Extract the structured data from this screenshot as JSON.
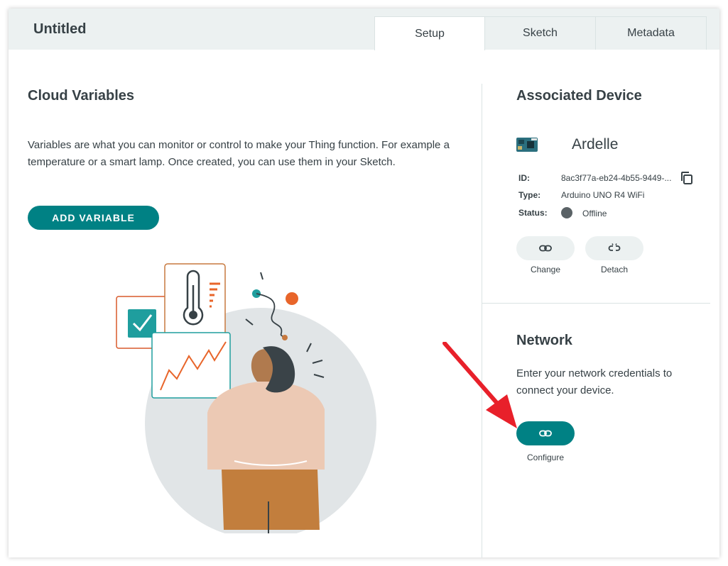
{
  "header": {
    "title": "Untitled",
    "tabs": [
      {
        "label": "Setup",
        "active": true
      },
      {
        "label": "Sketch",
        "active": false
      },
      {
        "label": "Metadata",
        "active": false
      }
    ]
  },
  "variables": {
    "title": "Cloud Variables",
    "description": "Variables are what you can monitor or control to make your Thing function. For example a temperature or a smart lamp. Once created, you can use them in your Sketch.",
    "add_button": "ADD VARIABLE"
  },
  "device": {
    "section_title": "Associated Device",
    "name": "Ardelle",
    "id_label": "ID:",
    "id_value": "8ac3f77a-eb24-4b55-9449-...",
    "type_label": "Type:",
    "type_value": "Arduino UNO R4 WiFi",
    "status_label": "Status:",
    "status_value": "Offline",
    "change_label": "Change",
    "detach_label": "Detach"
  },
  "network": {
    "title": "Network",
    "description": "Enter your network credentials to connect your device.",
    "configure_label": "Configure"
  },
  "colors": {
    "accent": "#008184",
    "annotation_arrow": "#e8202a",
    "status_offline": "#5a6266"
  },
  "icons": [
    "link-icon",
    "unlink-icon",
    "copy-icon",
    "board-icon"
  ]
}
